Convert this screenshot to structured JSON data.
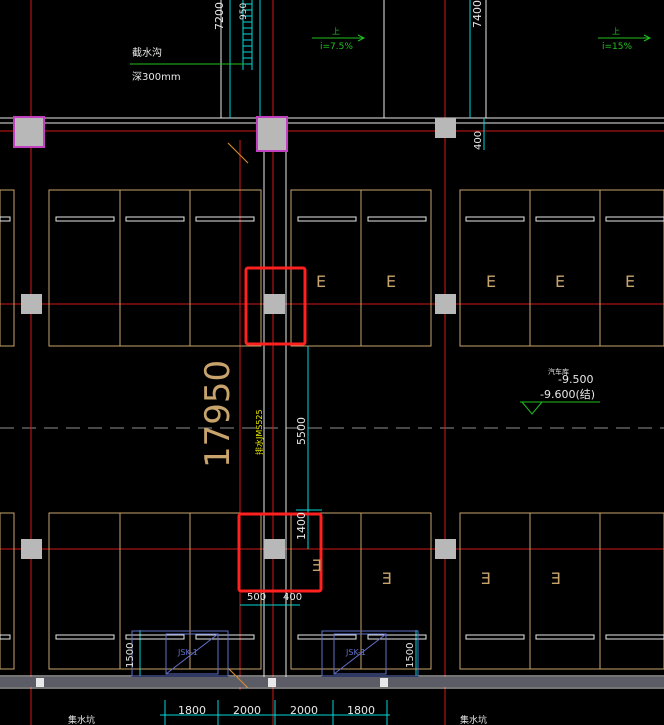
{
  "dims": {
    "top_7200": "7200",
    "top_950": "950",
    "top_7400": "7400",
    "side_400": "400",
    "overall_17950": "17950",
    "mid_5500": "5500",
    "mid_1400": "1400",
    "bot_500": "500",
    "bot_400": "400",
    "left_1500": "1500",
    "right_1500": "1500",
    "bottom_1800_a": "1800",
    "bottom_2000_a": "2000",
    "bottom_2000_b": "2000",
    "bottom_1800_b": "1800"
  },
  "notes": {
    "trench_title": "截水沟",
    "trench_depth": "深300mm",
    "slope_1_up": "上",
    "slope_1": "i=7.5%",
    "slope_2_up": "上",
    "slope_2": "i=15%",
    "floor_label": "汽车库",
    "elev_1": "-9.500",
    "elev_2": "-9.600(结)",
    "pipe_label": "排水JMS525",
    "pit_1": "JSK-1",
    "pit_2": "JSK-1",
    "sump_left": "集水坑",
    "sump_right": "集水坑"
  },
  "parking_marks": {
    "upper": [
      "E",
      "E",
      "E",
      "E",
      "E"
    ],
    "lower": [
      "E",
      "E",
      "E",
      "E"
    ]
  },
  "colors": {
    "background": "#000000",
    "axis_red": "#d01818",
    "dim_cyan": "#00d8d8",
    "wall_white": "#e8e8e8",
    "parking_tan": "#c8a46c",
    "column_gray": "#b8b8b8",
    "column_magenta": "#c040c0",
    "dim_orange": "#d08830",
    "green_leader": "#20c020",
    "yellow_text": "#e8e800",
    "highlight_red": "#ff2020",
    "pit_blue": "#6070c8",
    "dashed_gray": "#909090"
  }
}
